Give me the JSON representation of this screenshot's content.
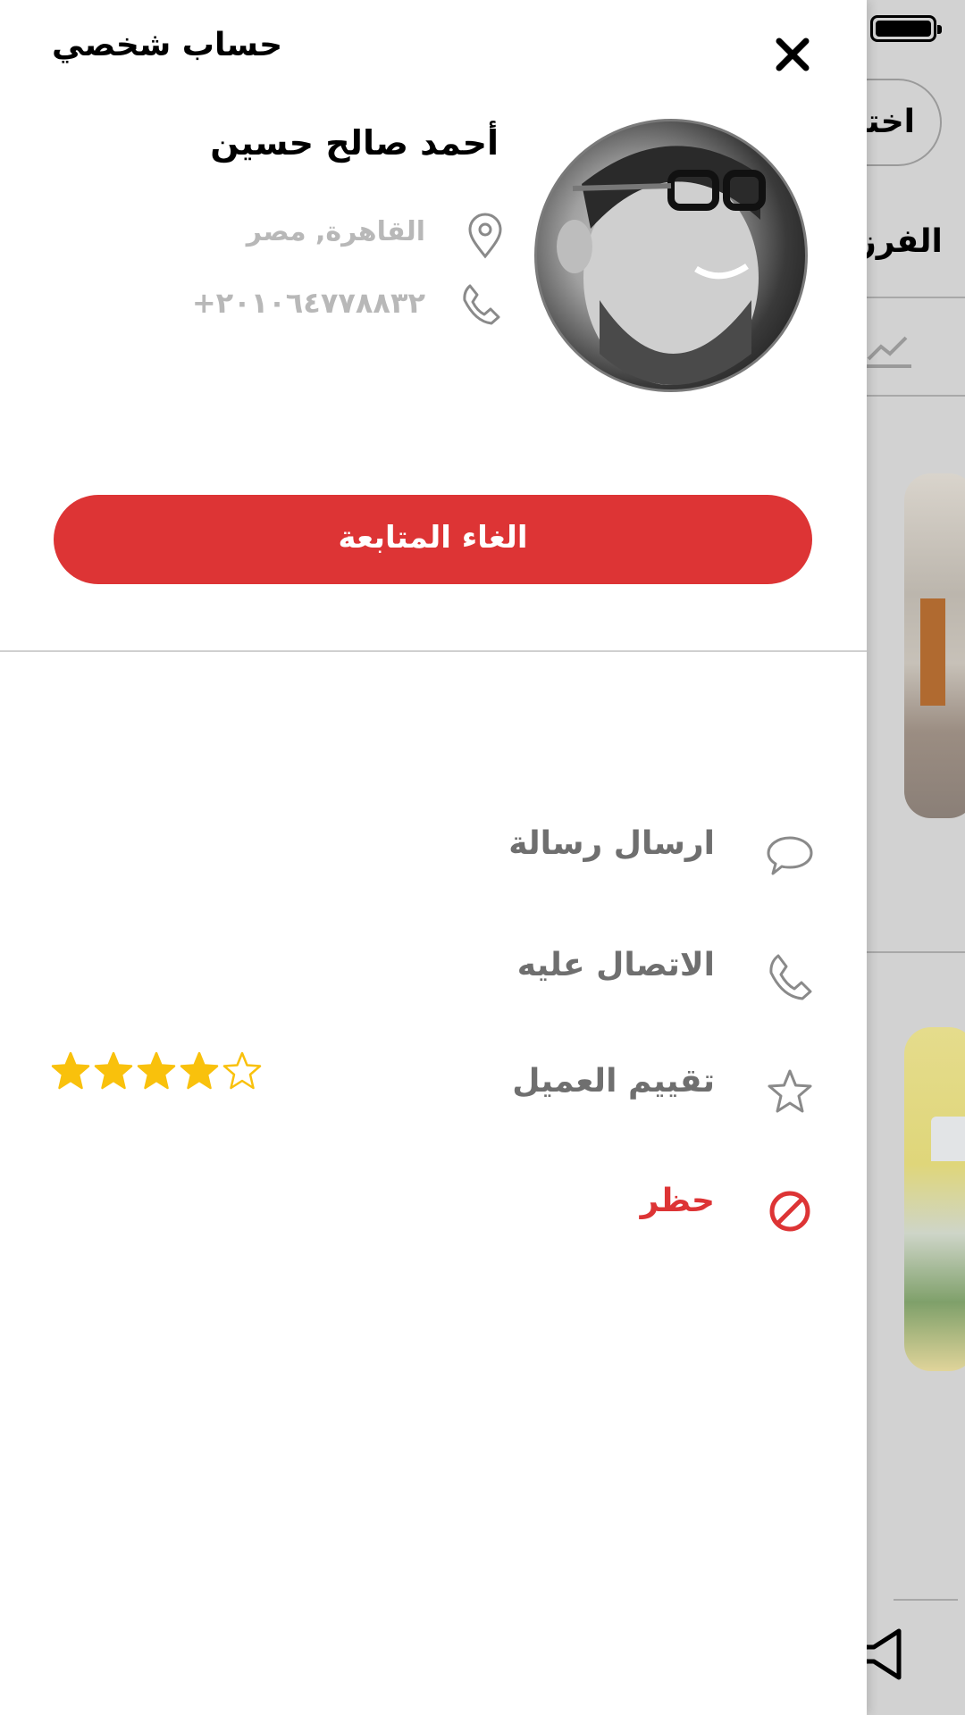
{
  "background": {
    "pill_label": "اختيار",
    "section_label": "الفرز",
    "battery_icon": "battery-icon",
    "trend_icon": "trend-up-icon",
    "nav_icon": "megaphone-icon"
  },
  "drawer": {
    "title": "حساب شخصي",
    "close_icon": "close-icon"
  },
  "profile": {
    "name": "أحمد صالح حسين",
    "location": "القاهرة, مصر",
    "phone": "+٢٠١٠٦٤٧٧٨٨٣٢",
    "location_icon": "location-pin-icon",
    "phone_icon": "phone-icon"
  },
  "actions": {
    "unfollow_label": "الغاء المتابعة"
  },
  "menu": {
    "items": [
      {
        "label": "ارسال رسالة",
        "icon": "chat-bubble-icon"
      },
      {
        "label": "الاتصال عليه",
        "icon": "phone-icon"
      },
      {
        "label": "تقييم العميل",
        "icon": "star-outline-icon"
      },
      {
        "label": "حظر",
        "icon": "block-icon"
      }
    ]
  },
  "rating": {
    "value": 4,
    "max": 5
  },
  "colors": {
    "accent_red": "#dd3435",
    "star_gold": "#f9c10c",
    "muted_gray": "#b8b8b8"
  }
}
